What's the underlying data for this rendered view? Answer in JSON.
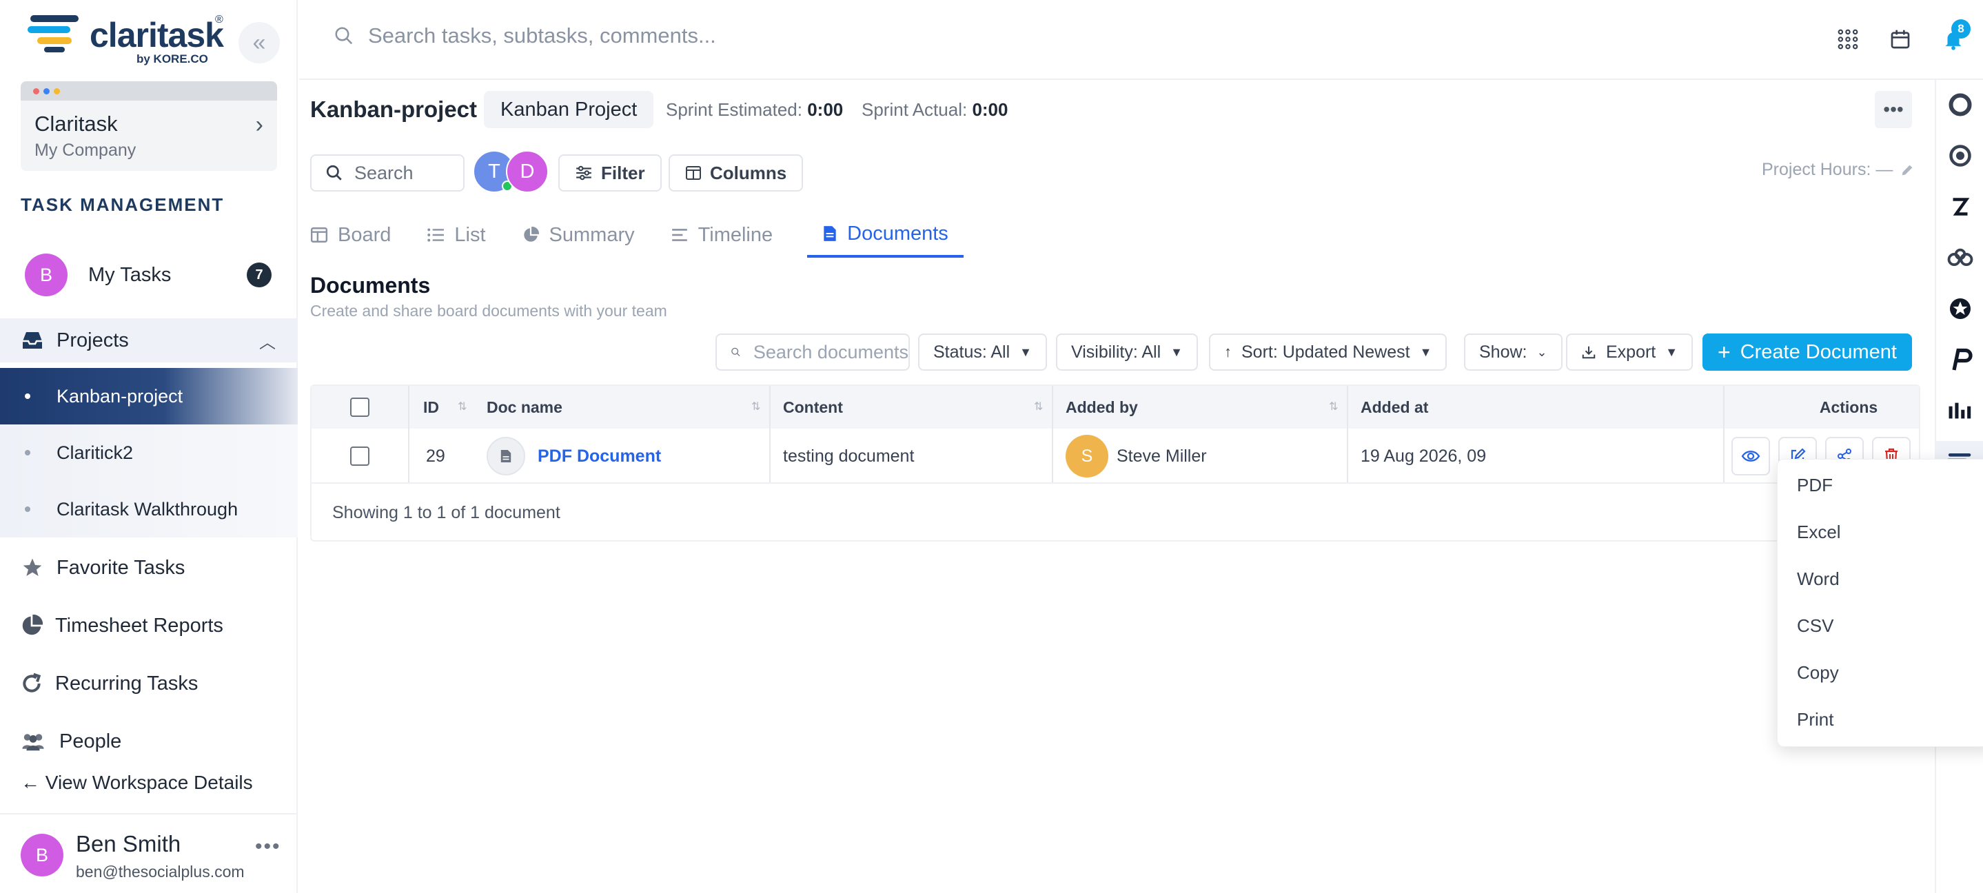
{
  "app": {
    "logo_text": "claritask",
    "logo_sub": "by KORE.CO",
    "logo_reg": "®"
  },
  "header": {
    "search_placeholder": "Search tasks, subtasks, comments...",
    "notification_count": "8"
  },
  "workspace": {
    "name": "Claritask",
    "company": "My Company"
  },
  "sidebar": {
    "section_title": "TASK MANAGEMENT",
    "my_tasks": {
      "avatar": "B",
      "label": "My Tasks",
      "count": "7"
    },
    "projects_label": "Projects",
    "projects": [
      {
        "label": "Kanban-project",
        "active": true
      },
      {
        "label": "Claritick2",
        "active": false
      },
      {
        "label": "Claritask Walkthrough",
        "active": false
      }
    ],
    "items": [
      {
        "label": "Favorite Tasks"
      },
      {
        "label": "Timesheet Reports"
      },
      {
        "label": "Recurring Tasks"
      },
      {
        "label": "People"
      }
    ],
    "view_workspace": "← View Workspace Details"
  },
  "user": {
    "avatar": "B",
    "name": "Ben Smith",
    "email": "ben@thesocialplus.com"
  },
  "project": {
    "title": "Kanban-project",
    "pill": "Kanban Project",
    "sprint_estimated_label": "Sprint Estimated:",
    "sprint_estimated_value": "0:00",
    "sprint_actual_label": "Sprint Actual:",
    "sprint_actual_value": "0:00",
    "search_placeholder": "Search",
    "avatars": [
      "T",
      "D"
    ],
    "filter_label": "Filter",
    "columns_label": "Columns",
    "hours_label": "Project Hours: —"
  },
  "tabs": [
    {
      "label": "Board",
      "active": false
    },
    {
      "label": "List",
      "active": false
    },
    {
      "label": "Summary",
      "active": false
    },
    {
      "label": "Timeline",
      "active": false
    },
    {
      "label": "Documents",
      "active": true
    }
  ],
  "documents": {
    "title": "Documents",
    "subtitle": "Create and share board documents with your team",
    "search_placeholder": "Search documents",
    "status_filter": "Status: All",
    "visibility_filter": "Visibility: All",
    "sort": "Sort: Updated Newest",
    "show": "Show:",
    "export": "Export",
    "create": "Create Document",
    "columns": [
      "ID",
      "Doc name",
      "Content",
      "Added by",
      "Added at",
      "Actions"
    ],
    "rows": [
      {
        "id": "29",
        "doc_name": "PDF Document",
        "content": "testing document",
        "added_by_avatar": "S",
        "added_by": "Steve Miller",
        "added_at": "19 Aug 2026, 09"
      }
    ],
    "showing": "Showing 1 to 1 of 1 document"
  },
  "export_menu": [
    "PDF",
    "Excel",
    "Word",
    "CSV",
    "Copy",
    "Print"
  ],
  "colors": {
    "accent": "#2563eb",
    "create_button": "#0ea5e9",
    "sidebar_active": "#1e3a6e",
    "avatar_purple": "#d05ce3",
    "avatar_orange": "#f0b44c"
  }
}
